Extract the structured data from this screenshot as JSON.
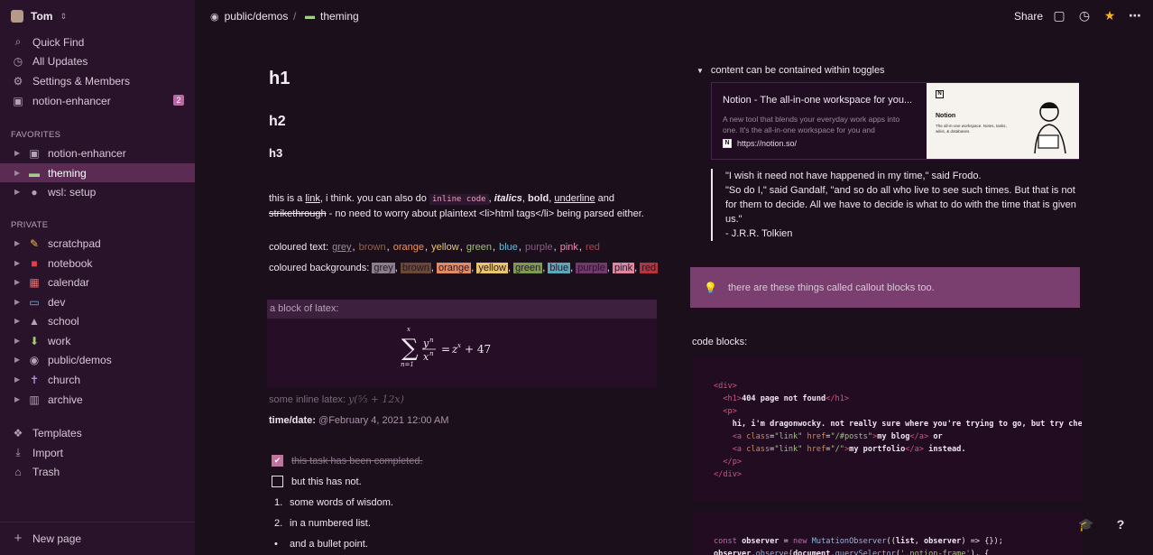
{
  "workspace": {
    "name": "Tom"
  },
  "sidebar": {
    "top_items": [
      {
        "label": "Quick Find",
        "icon": "search-icon"
      },
      {
        "label": "All Updates",
        "icon": "clock-icon"
      },
      {
        "label": "Settings & Members",
        "icon": "gear-icon"
      },
      {
        "label": "notion-enhancer",
        "icon": "page-icon",
        "badge": "2"
      }
    ],
    "favorites_heading": "FAVORITES",
    "favorites": [
      {
        "label": "notion-enhancer",
        "icon": "page-icon"
      },
      {
        "label": "theming",
        "icon": "window-icon",
        "active": true
      },
      {
        "label": "wsl: setup",
        "icon": "penguin-icon"
      }
    ],
    "private_heading": "PRIVATE",
    "private": [
      {
        "label": "scratchpad",
        "icon": "pencil-icon"
      },
      {
        "label": "notebook",
        "icon": "book-icon"
      },
      {
        "label": "calendar",
        "icon": "calendar-icon"
      },
      {
        "label": "dev",
        "icon": "laptop-icon"
      },
      {
        "label": "school",
        "icon": "cap-icon"
      },
      {
        "label": "work",
        "icon": "download-icon"
      },
      {
        "label": "public/demos",
        "icon": "eye-icon"
      },
      {
        "label": "church",
        "icon": "cross-icon"
      },
      {
        "label": "archive",
        "icon": "trash-bin-icon"
      }
    ],
    "bottom_items": [
      {
        "label": "Templates",
        "icon": "templates-icon"
      },
      {
        "label": "Import",
        "icon": "import-icon"
      },
      {
        "label": "Trash",
        "icon": "trash-icon"
      }
    ],
    "new_page": "New page"
  },
  "topbar": {
    "breadcrumb": [
      "public/demos",
      "theming"
    ],
    "separator": "/",
    "share": "Share"
  },
  "page": {
    "h1": "h1",
    "h2": "h2",
    "h3": "h3",
    "para": {
      "a": "this is a ",
      "link": "link",
      "b": ", i think. you can also do ",
      "code": "inline code",
      "c": ", ",
      "italics": "italics",
      "d": ", ",
      "bold": "bold",
      "e": ", ",
      "underline": "underline",
      "f": " and ",
      "strike": "strikethrough",
      "g": " - no need to worry about plaintext <li>html tags</li> being parsed either."
    },
    "coloured_text_label": "coloured text:",
    "coloured_text": [
      {
        "label": "grey",
        "color": "#9b8b9b"
      },
      {
        "label": "brown",
        "color": "#8a6450"
      },
      {
        "label": "orange",
        "color": "#e8925a"
      },
      {
        "label": "yellow",
        "color": "#e8c46a"
      },
      {
        "label": "green",
        "color": "#9cc06f"
      },
      {
        "label": "blue",
        "color": "#6fb7d8"
      },
      {
        "label": "purple",
        "color": "#8d5a8d"
      },
      {
        "label": "pink",
        "color": "#e790b3"
      },
      {
        "label": "red",
        "color": "#b4414b"
      }
    ],
    "coloured_backgrounds_label": "coloured backgrounds:",
    "coloured_backgrounds": [
      {
        "label": "grey",
        "color": "#8a7f8a"
      },
      {
        "label": "brown",
        "color": "#6a4836"
      },
      {
        "label": "orange",
        "color": "#e28b62"
      },
      {
        "label": "yellow",
        "color": "#e9c56c"
      },
      {
        "label": "green",
        "color": "#7d9a4f"
      },
      {
        "label": "blue",
        "color": "#5ba8b8"
      },
      {
        "label": "purple",
        "color": "#6e3a6a"
      },
      {
        "label": "pink",
        "color": "#e2859f"
      },
      {
        "label": "red",
        "color": "#b2353d"
      }
    ],
    "latex_label": "a block of latex:",
    "inline_latex_label": "some inline latex:",
    "datetime_label": "time/date:",
    "datetime_value": "@February 4, 2021 12:00 AM",
    "todos": [
      {
        "label": "this task has been completed.",
        "done": true
      },
      {
        "label": "but this has not.",
        "done": false
      }
    ],
    "numbered": [
      {
        "num": "1.",
        "label": "some words of wisdom."
      },
      {
        "num": "2.",
        "label": "in a numbered list."
      }
    ],
    "bullet": "and a bullet point.",
    "toggle_label": "content can be contained within toggles",
    "bookmark": {
      "title": "Notion - The all-in-one workspace for you...",
      "description": "A new tool that blends your everyday work apps into one. It's the all-in-one workspace for you and",
      "url": "https://notion.so/",
      "thumb_title": "Notion",
      "thumb_sub": "The all-in-one workspace. Notes, tasks, wikis, & databases."
    },
    "quote": [
      "\"I wish it need not have happened in my time,\" said Frodo.",
      "\"So do I,\" said Gandalf, \"and so do all who live to see such times. But that is not for them to decide. All we have to decide is what to do with the time that is given us.\"",
      "- J.R.R. Tolkien"
    ],
    "callout": "there are these things called callout blocks too.",
    "code_label": "code blocks:"
  }
}
